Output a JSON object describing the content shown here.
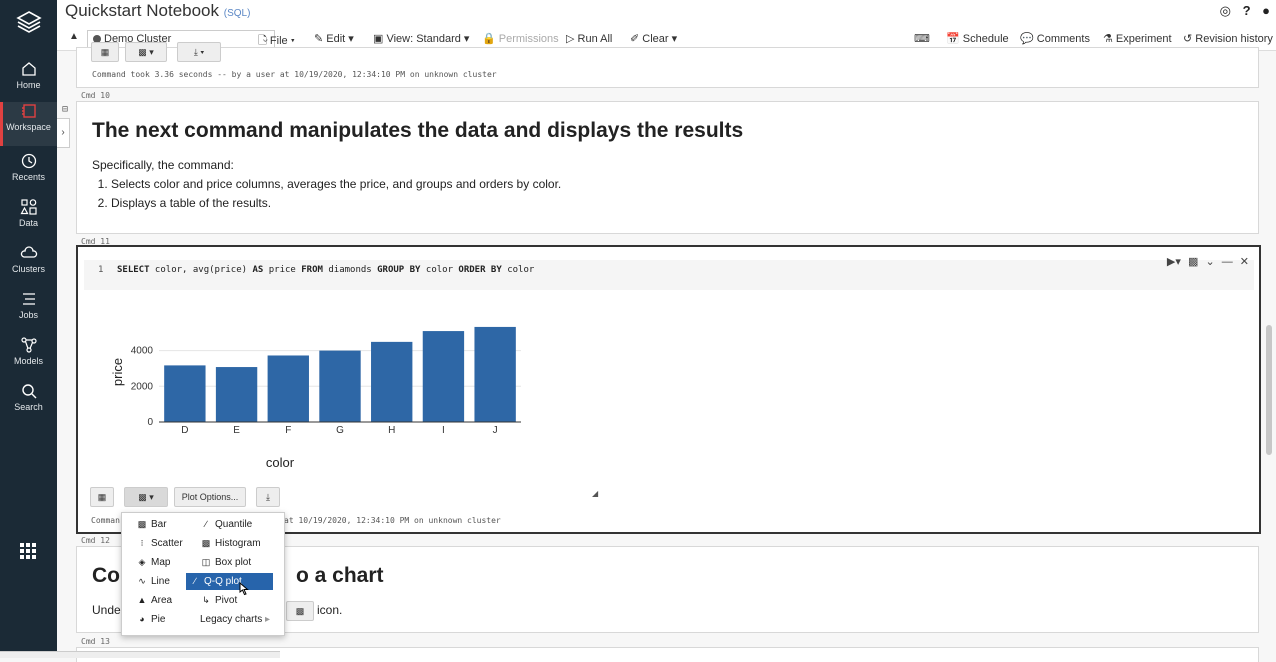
{
  "header": {
    "title": "Quickstart Notebook",
    "lang": "(SQL)",
    "cluster": "Demo Cluster",
    "menus": {
      "file": "File",
      "edit": "Edit",
      "view": "View: Standard",
      "permissions": "Permissions",
      "run_all": "Run All",
      "clear": "Clear"
    },
    "right_links": {
      "schedule": "Schedule",
      "comments": "Comments",
      "experiment": "Experiment",
      "revision_history": "Revision history"
    }
  },
  "nav": {
    "items": [
      {
        "label": "Home",
        "icon": "home-icon"
      },
      {
        "label": "Workspace",
        "icon": "workspace-icon"
      },
      {
        "label": "Recents",
        "icon": "clock-icon"
      },
      {
        "label": "Data",
        "icon": "data-icon"
      },
      {
        "label": "Clusters",
        "icon": "cloud-icon"
      },
      {
        "label": "Jobs",
        "icon": "list-icon"
      },
      {
        "label": "Models",
        "icon": "models-icon"
      },
      {
        "label": "Search",
        "icon": "search-icon"
      }
    ]
  },
  "cells": {
    "prev_status": "Command took 3.36 seconds -- by a user at 10/19/2020, 12:34:10 PM on unknown cluster",
    "cmd10": "Cmd 10",
    "cmd10_heading": "The next command manipulates the data and displays the results",
    "cmd10_intro": "Specifically, the command:",
    "cmd10_list": [
      "Selects color and price columns, averages the price, and groups and orders by color.",
      "Displays a table of the results."
    ],
    "cmd11": "Cmd 11",
    "line_no": "1",
    "code": {
      "k1": "SELECT",
      "t1": " color, avg(price) ",
      "k2": "AS",
      "t2": " price ",
      "k3": "FROM",
      "t3": " diamonds ",
      "k4": "GROUP BY",
      "t4": " color ",
      "k5": "ORDER BY",
      "t5": " color"
    },
    "plot_options": "Plot Options...",
    "cmd11_status_left": "Comman",
    "cmd11_status_right": "at 10/19/2020, 12:34:10 PM on unknown cluster",
    "cmd12": "Cmd 12",
    "cmd12_heading_left": "Co",
    "cmd12_heading_right": "o a chart",
    "cmd12_text_left": "Unde",
    "cmd12_text_right": "icon.",
    "cmd13": "Cmd 13"
  },
  "plot_menu": {
    "left": [
      {
        "label": "Bar",
        "icon": "bar-chart-icon"
      },
      {
        "label": "Scatter",
        "icon": "scatter-icon"
      },
      {
        "label": "Map",
        "icon": "map-icon"
      },
      {
        "label": "Line",
        "icon": "line-chart-icon"
      },
      {
        "label": "Area",
        "icon": "area-chart-icon"
      },
      {
        "label": "Pie",
        "icon": "pie-chart-icon"
      }
    ],
    "right": [
      {
        "label": "Quantile",
        "icon": "quantile-icon"
      },
      {
        "label": "Histogram",
        "icon": "histogram-icon"
      },
      {
        "label": "Box plot",
        "icon": "box-plot-icon"
      },
      {
        "label": "Q-Q plot",
        "icon": "qq-plot-icon",
        "selected": true
      },
      {
        "label": "Pivot",
        "icon": "pivot-icon"
      },
      {
        "label": "Legacy charts",
        "icon": "chevron-right-icon"
      }
    ]
  },
  "chart_data": {
    "type": "bar",
    "categories": [
      "D",
      "E",
      "F",
      "G",
      "H",
      "I",
      "J"
    ],
    "values": [
      3170,
      3077,
      3725,
      3999,
      4487,
      5092,
      5324
    ],
    "xlabel": "color",
    "ylabel": "price",
    "yticks": [
      0,
      2000,
      4000
    ],
    "ylim": [
      0,
      5600
    ],
    "bar_color": "#2e67a6"
  },
  "colors": {
    "nav_bg": "#1b2a36",
    "accent": "#e04141",
    "menu_selected": "#2764ab"
  }
}
